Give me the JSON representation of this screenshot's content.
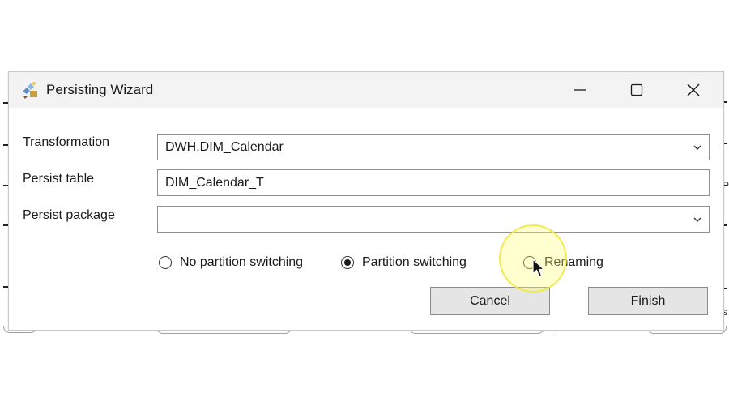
{
  "window": {
    "title": "Persisting Wizard",
    "app_icon": "wizard-app-icon",
    "controls": {
      "minimize_icon": "minimize-icon",
      "maximize_icon": "maximize-icon",
      "close_icon": "close-icon"
    }
  },
  "form": {
    "transformation": {
      "label": "Transformation",
      "value": "DWH.DIM_Calendar"
    },
    "persist_table": {
      "label": "Persist table",
      "value": "DIM_Calendar_T"
    },
    "persist_package": {
      "label": "Persist package",
      "value": ""
    }
  },
  "mode_options": {
    "options": [
      {
        "label": "No partition switching",
        "checked": false
      },
      {
        "label": "Partition switching",
        "checked": true
      },
      {
        "label": "Renaming",
        "checked": false
      }
    ]
  },
  "buttons": {
    "cancel_label": "Cancel",
    "finish_label": "Finish"
  },
  "background_fragments": {
    "right_edge_glyphs": [
      "P",
      "s"
    ]
  },
  "colors": {
    "titlebar": "#f3f3f3",
    "button_face": "#e5e5e5",
    "click_highlight": "#fff578"
  }
}
